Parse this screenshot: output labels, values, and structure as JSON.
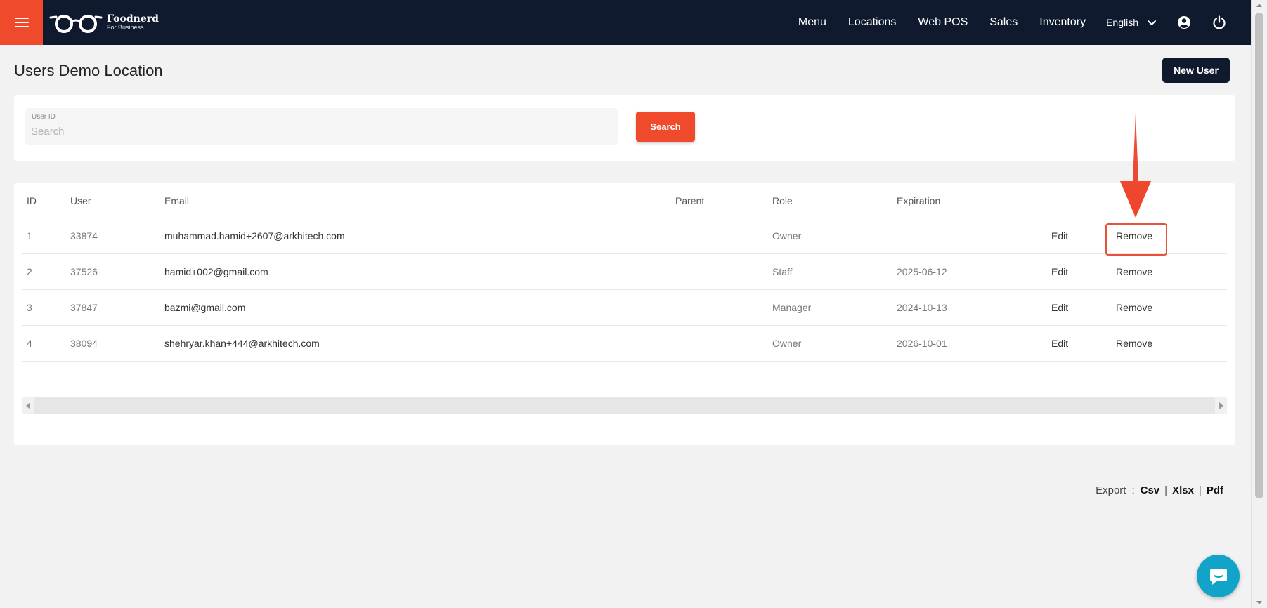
{
  "header": {
    "brand_name": "Foodnerd",
    "brand_sub": "For Business",
    "nav": [
      "Menu",
      "Locations",
      "Web POS",
      "Sales",
      "Inventory"
    ],
    "language": "English"
  },
  "page": {
    "title": "Users Demo Location",
    "new_user_label": "New User"
  },
  "search": {
    "label": "User ID",
    "placeholder": "Search",
    "value": "",
    "button_label": "Search"
  },
  "table": {
    "headers": {
      "id": "ID",
      "user": "User",
      "email": "Email",
      "parent": "Parent",
      "role": "Role",
      "expiration": "Expiration"
    },
    "rows": [
      {
        "id": "1",
        "user": "33874",
        "email": "muhammad.hamid+2607@arkhitech.com",
        "parent": "",
        "role": "Owner",
        "expiration": "",
        "edit": "Edit",
        "remove": "Remove"
      },
      {
        "id": "2",
        "user": "37526",
        "email": "hamid+002@gmail.com",
        "parent": "",
        "role": "Staff",
        "expiration": "2025-06-12",
        "edit": "Edit",
        "remove": "Remove"
      },
      {
        "id": "3",
        "user": "37847",
        "email": "bazmi@gmail.com",
        "parent": "",
        "role": "Manager",
        "expiration": "2024-10-13",
        "edit": "Edit",
        "remove": "Remove"
      },
      {
        "id": "4",
        "user": "38094",
        "email": "shehryar.khan+444@arkhitech.com",
        "parent": "",
        "role": "Owner",
        "expiration": "2026-10-01",
        "edit": "Edit",
        "remove": "Remove"
      }
    ]
  },
  "export": {
    "label": "Export",
    "colon": ":",
    "separator": "|",
    "formats": [
      "Csv",
      "Xlsx",
      "Pdf"
    ]
  },
  "colors": {
    "navbar": "#0f1a2e",
    "accent": "#f04a2c",
    "annotation": "#e8523a",
    "chat": "#12a4c8"
  },
  "icons": {
    "menu": "hamburger-icon",
    "logo": "glasses-icon",
    "language_dropdown": "chevron-down-icon",
    "account": "user-circle-icon",
    "logout": "power-icon",
    "chat": "chat-bubble-icon",
    "annotation": "red-arrow-icon"
  }
}
